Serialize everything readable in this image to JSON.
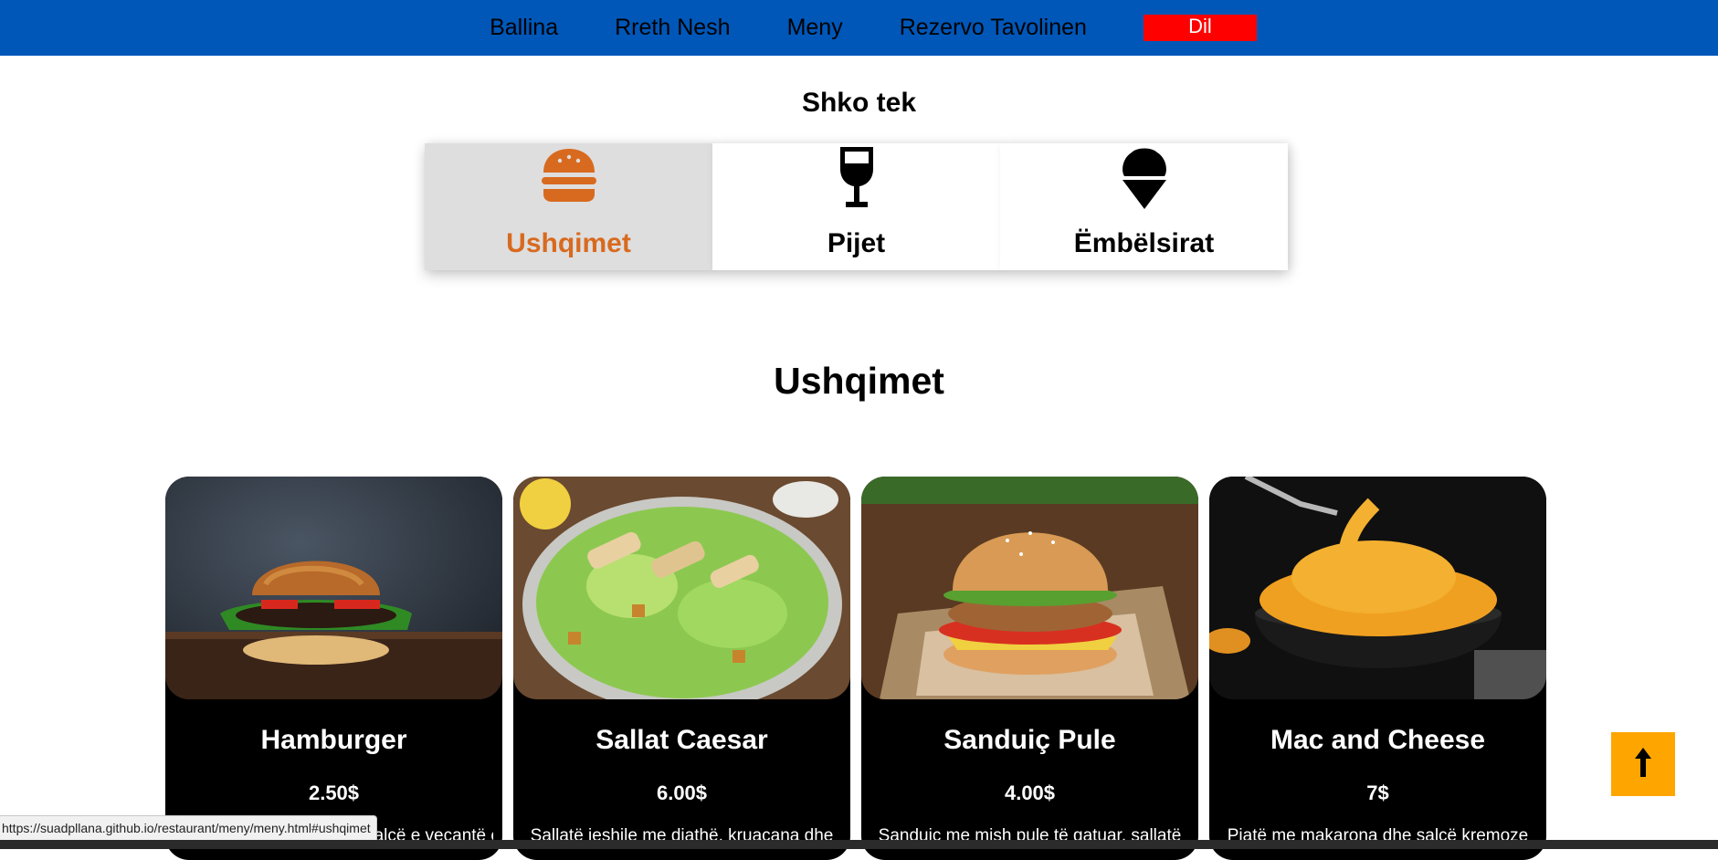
{
  "nav": {
    "links": [
      "Ballina",
      "Rreth Nesh",
      "Meny",
      "Rezervo Tavolinen"
    ],
    "lang_button": "Dil",
    "bg_color": "#0057b8",
    "lang_color": "#ff0000"
  },
  "goto": {
    "title": "Shko tek",
    "categories": [
      {
        "label": "Ushqimet",
        "icon": "burger-icon",
        "active": true
      },
      {
        "label": "Pijet",
        "icon": "wine-glass-icon",
        "active": false
      },
      {
        "label": "Ëmbëlsirat",
        "icon": "ice-cream-icon",
        "active": false
      }
    ],
    "active_color": "#d86a1f"
  },
  "section": {
    "title": "Ushqimet"
  },
  "menu_items": [
    {
      "name": "Hamburger",
      "price": "2.50$",
      "description": "Burger me mish viçi dhe salcë e veçantë e shefit, përbërës të",
      "image": "burger-photo"
    },
    {
      "name": "Sallat Caesar",
      "price": "6.00$",
      "description": "Sallatë jeshile me djathë, kruacana dhe",
      "image": "caesar-salad-photo"
    },
    {
      "name": "Sanduiç Pule",
      "price": "4.00$",
      "description": "Sanduiç me mish pule të gatuar, sallatë",
      "image": "chicken-sandwich-photo"
    },
    {
      "name": "Mac and Cheese",
      "price": "7$",
      "description": "Pjatë me makarona dhe salcë kremoze",
      "image": "mac-and-cheese-photo"
    }
  ],
  "scroll_top": {
    "icon": "arrow-up-icon",
    "color": "#ffa500"
  },
  "status_bar": {
    "url": "https://suadpllana.github.io/restaurant/meny/meny.html#ushqimet"
  }
}
